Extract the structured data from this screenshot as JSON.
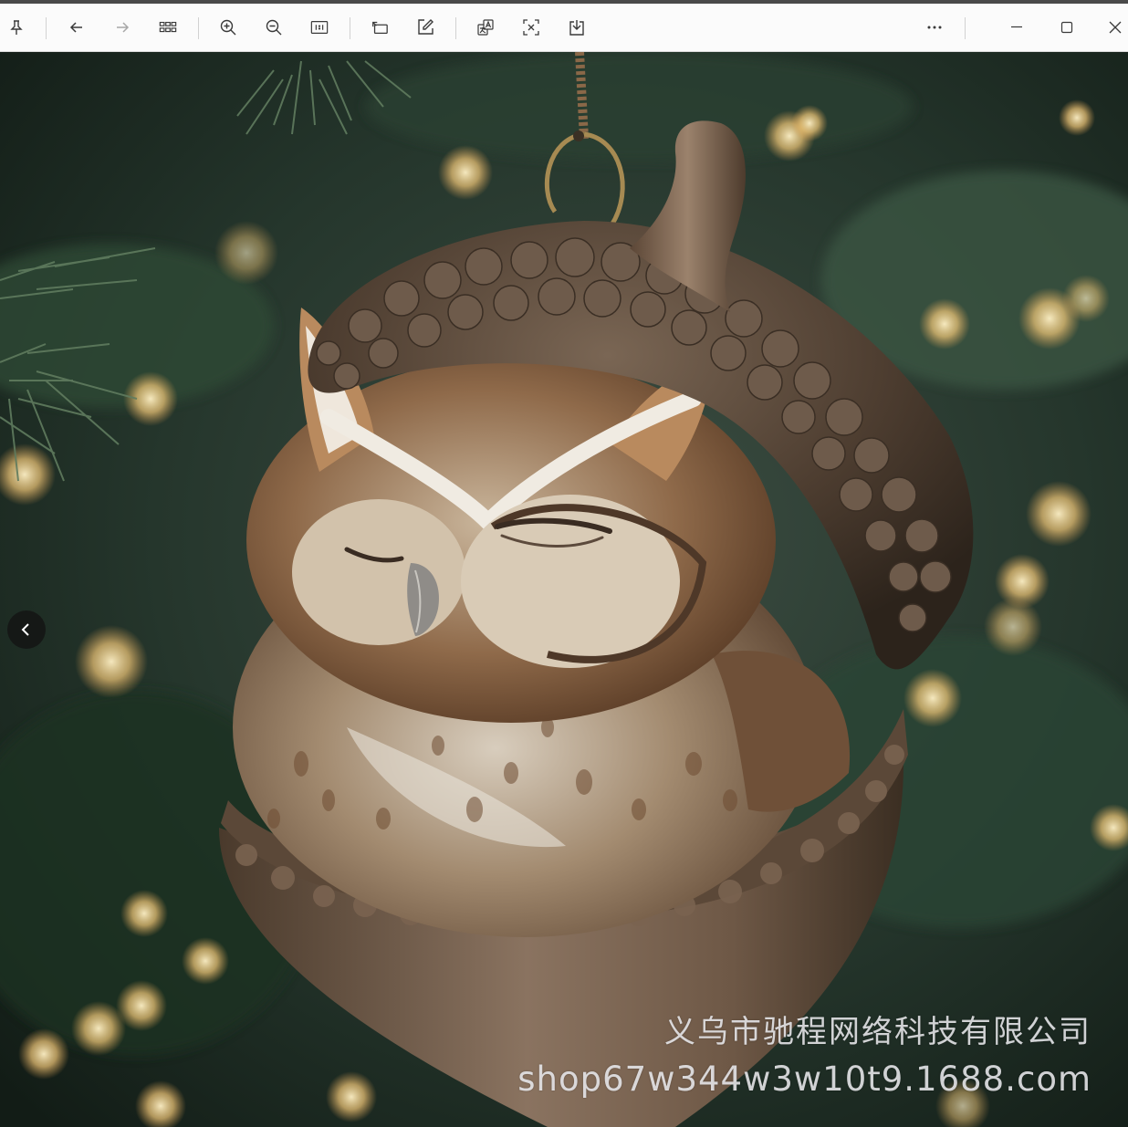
{
  "toolbar": {
    "buttons": [
      {
        "name": "pin-icon",
        "tooltip": "Pin"
      },
      {
        "name": "back-arrow-icon",
        "tooltip": "Previous"
      },
      {
        "name": "forward-arrow-icon",
        "tooltip": "Next"
      },
      {
        "name": "grid-view-icon",
        "tooltip": "Gallery"
      },
      {
        "name": "zoom-in-icon",
        "tooltip": "Zoom in"
      },
      {
        "name": "zoom-out-icon",
        "tooltip": "Zoom out"
      },
      {
        "name": "actual-size-icon",
        "tooltip": "1:1"
      },
      {
        "name": "rotate-icon",
        "tooltip": "Rotate"
      },
      {
        "name": "edit-icon",
        "tooltip": "Edit"
      },
      {
        "name": "translate-icon",
        "tooltip": "Translate"
      },
      {
        "name": "extract-text-icon",
        "tooltip": "Extract text"
      },
      {
        "name": "download-icon",
        "tooltip": "Save"
      },
      {
        "name": "more-icon",
        "tooltip": "More"
      }
    ],
    "window_controls": [
      "minimize-icon",
      "maximize-icon",
      "close-icon"
    ]
  },
  "image": {
    "subject": "sleeping owl acorn ornament",
    "watermark_company": "义乌市驰程网络科技有限公司",
    "watermark_url": "shop67w344w3w10t9.1688.com"
  },
  "colors": {
    "toolbar_bg": "#fbfbfb",
    "icon": "#3a3a3a",
    "watermark": "#ebebee"
  }
}
